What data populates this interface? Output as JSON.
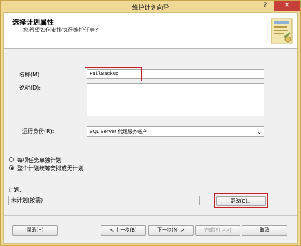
{
  "window": {
    "title": "维护计划向导",
    "help_glyph": "?",
    "close_glyph": "✕"
  },
  "header": {
    "title": "选择计划属性",
    "subtitle": "您希望如何安排执行维护任务?"
  },
  "form": {
    "name_label": "名称(M):",
    "name_value": "FullBackup",
    "description_label": "说明(D):",
    "description_value": "",
    "run_as_label": "运行身份(R):",
    "run_as_value": "SQL Server 代理服务帐户",
    "radio_separate_label": "每项任务单独计划",
    "radio_single_label": "整个计划统筹安排或无计划",
    "selected_radio": "single",
    "schedule_label": "计划:",
    "schedule_value": "未计划(按需)",
    "change_button": "更改(C)..."
  },
  "footer": {
    "help_button": "帮助(H)",
    "back_button": "< 上一步(B)",
    "next_button": "下一步(N) >",
    "finish_button": "完成(F) >>|",
    "cancel_button": "取消"
  },
  "icons": {
    "dropdown": "chevron-down-icon",
    "wizard": "wizard-document-icon"
  },
  "colors": {
    "title_bar": "#f0d996",
    "close_button": "#c7403a",
    "highlight_box": "#c81e28",
    "dialog_bg": "#f0f0f0"
  }
}
